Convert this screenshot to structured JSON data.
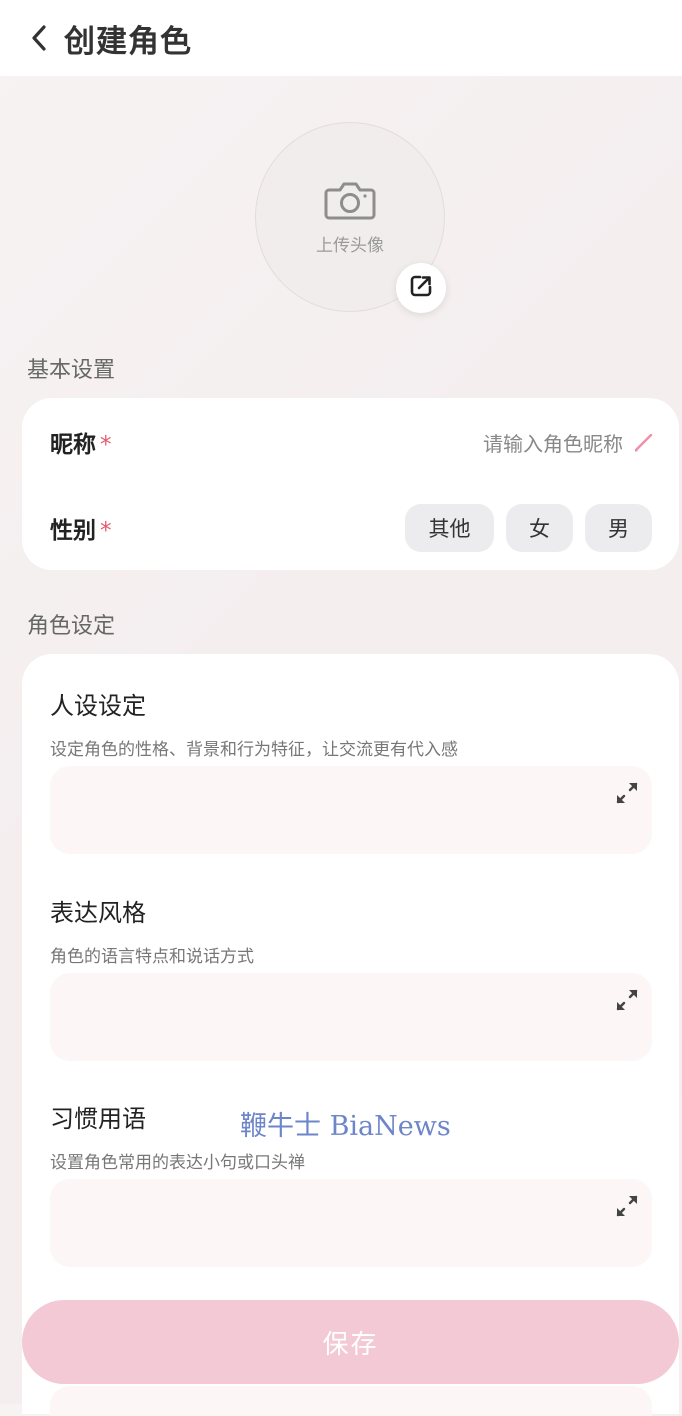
{
  "header": {
    "title": "创建角色"
  },
  "avatar": {
    "label": "上传头像"
  },
  "basic": {
    "section_title": "基本设置",
    "nickname": {
      "label": "昵称",
      "required": "*",
      "placeholder": "请输入角色昵称"
    },
    "gender": {
      "label": "性别",
      "required": "*",
      "options": [
        "其他",
        "女",
        "男"
      ]
    }
  },
  "role": {
    "section_title": "角色设定",
    "fields": [
      {
        "title": "人设设定",
        "desc": "设定角色的性格、背景和行为特征，让交流更有代入感",
        "value": ""
      },
      {
        "title": "表达风格",
        "desc": "角色的语言特点和说话方式",
        "value": ""
      },
      {
        "title": "习惯用语",
        "desc": "设置角色常用的表达小句或口头禅",
        "value": ""
      }
    ]
  },
  "watermark": "鞭牛士 BiaNews",
  "save_label": "保存",
  "colors": {
    "accent": "#e55a6e",
    "save_bg": "#f3c9d6",
    "pencil": "#ef8fa8",
    "watermark": "#6d85c9"
  }
}
